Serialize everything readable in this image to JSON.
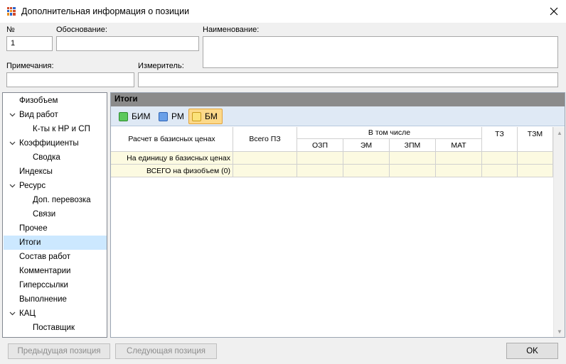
{
  "window": {
    "title": "Дополнительная информация о позиции"
  },
  "form": {
    "number_label": "№",
    "number_value": "1",
    "basis_label": "Обоснование:",
    "basis_value": "",
    "name_label": "Наименование:",
    "name_value": "",
    "notes_label": "Примечания:",
    "notes_value": "",
    "unit_label": "Измеритель:",
    "unit_value": ""
  },
  "tree": {
    "items": [
      {
        "label": "Физобъем",
        "level": 0,
        "expandable": false
      },
      {
        "label": "Вид работ",
        "level": 0,
        "expandable": true
      },
      {
        "label": "К-ты к НР и СП",
        "level": 1,
        "expandable": false
      },
      {
        "label": "Коэффициенты",
        "level": 0,
        "expandable": true
      },
      {
        "label": "Сводка",
        "level": 1,
        "expandable": false
      },
      {
        "label": "Индексы",
        "level": 0,
        "expandable": false
      },
      {
        "label": "Ресурс",
        "level": 0,
        "expandable": true
      },
      {
        "label": "Доп. перевозка",
        "level": 1,
        "expandable": false
      },
      {
        "label": "Связи",
        "level": 1,
        "expandable": false
      },
      {
        "label": "Прочее",
        "level": 0,
        "expandable": false
      },
      {
        "label": "Итоги",
        "level": 0,
        "expandable": false,
        "selected": true
      },
      {
        "label": "Состав работ",
        "level": 0,
        "expandable": false
      },
      {
        "label": "Комментарии",
        "level": 0,
        "expandable": false
      },
      {
        "label": "Гиперссылки",
        "level": 0,
        "expandable": false
      },
      {
        "label": "Выполнение",
        "level": 0,
        "expandable": false
      },
      {
        "label": "КАЦ",
        "level": 0,
        "expandable": true
      },
      {
        "label": "Поставщик",
        "level": 1,
        "expandable": false
      }
    ]
  },
  "panel": {
    "title": "Итоги",
    "tabs": [
      {
        "label": "БИМ",
        "color": "#5cc85c",
        "border": "#2e8b2e",
        "active": false
      },
      {
        "label": "РМ",
        "color": "#6aa0e8",
        "border": "#2f64b5",
        "active": false
      },
      {
        "label": "БМ",
        "color": "#fbe27a",
        "border": "#c99a1e",
        "active": true
      }
    ]
  },
  "table": {
    "headers": {
      "calc": "Расчет в базисных ценах",
      "total_pz": "Всего ПЗ",
      "including": "В том числе",
      "ozp": "ОЗП",
      "em": "ЭМ",
      "zpm": "ЗПМ",
      "mat": "МАТ",
      "tz": "ТЗ",
      "tzm": "ТЗМ"
    },
    "rows": [
      {
        "label": "На единицу в базисных ценах",
        "values": [
          "",
          "",
          "",
          "",
          "",
          "",
          ""
        ]
      },
      {
        "label": "ВСЕГО на физобъем (0)",
        "values": [
          "",
          "",
          "",
          "",
          "",
          "",
          ""
        ]
      }
    ]
  },
  "buttons": {
    "prev": "Предыдущая позиция",
    "next": "Следующая позиция",
    "ok": "OK"
  },
  "colors": {
    "selection": "#cce8ff",
    "panel_header": "#8b8b8b",
    "toolbar": "#dfe9f5",
    "row_fill": "#fcfae1",
    "active_tab": "#fcd98a"
  }
}
